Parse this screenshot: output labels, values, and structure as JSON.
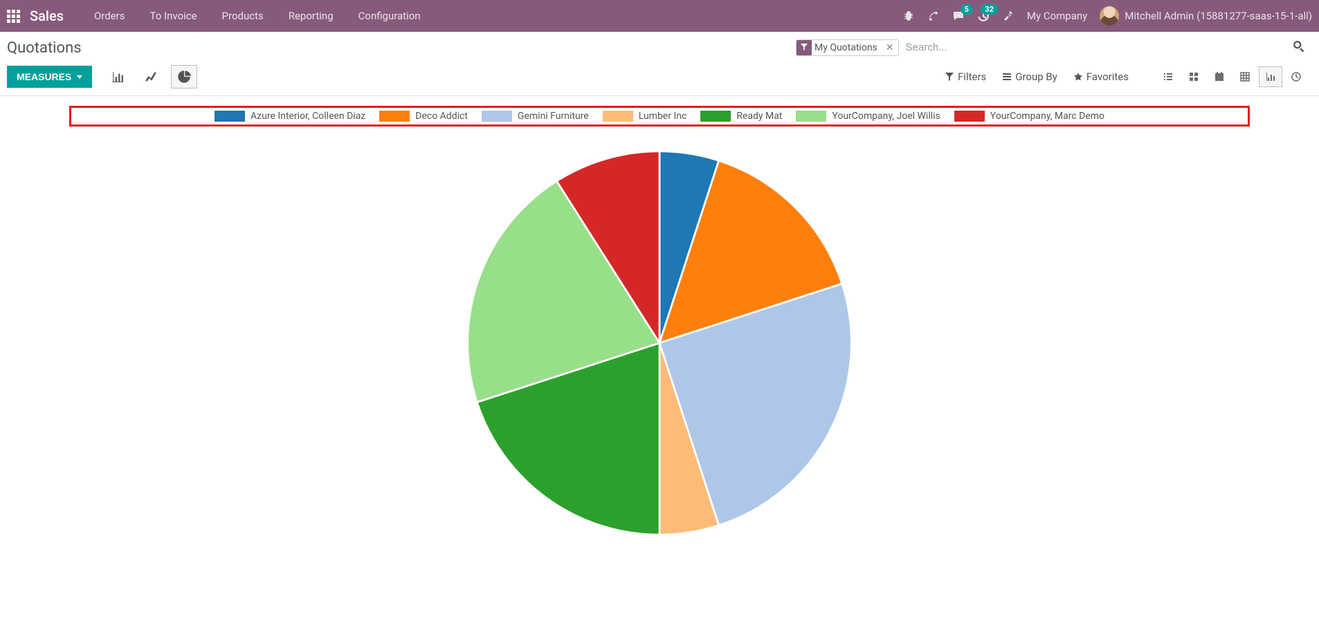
{
  "navbar": {
    "brand": "Sales",
    "links": [
      "Orders",
      "To Invoice",
      "Products",
      "Reporting",
      "Configuration"
    ],
    "msg_badge": "5",
    "activity_badge": "32",
    "company": "My Company",
    "user": "Mitchell Admin (15881277-saas-15-1-all)"
  },
  "page_title": "Quotations",
  "search": {
    "chip_label": "My Quotations",
    "placeholder": "Search..."
  },
  "toolbar": {
    "measures": "MEASURES",
    "filters": "Filters",
    "group_by": "Group By",
    "favorites": "Favorites"
  },
  "chart_data": {
    "type": "pie",
    "title": "",
    "series": [
      {
        "name": "Azure Interior, Colleen Diaz",
        "value": 5,
        "color": "#1f77b4"
      },
      {
        "name": "Deco Addict",
        "value": 15,
        "color": "#ff7f0e"
      },
      {
        "name": "Gemini Furniture",
        "value": 25,
        "color": "#aec7e8"
      },
      {
        "name": "Lumber Inc",
        "value": 5,
        "color": "#ffbb78"
      },
      {
        "name": "Ready Mat",
        "value": 20,
        "color": "#2ca02c"
      },
      {
        "name": "YourCompany, Joel Willis",
        "value": 21,
        "color": "#98df8a"
      },
      {
        "name": "YourCompany, Marc Demo",
        "value": 9,
        "color": "#d62728"
      }
    ]
  }
}
